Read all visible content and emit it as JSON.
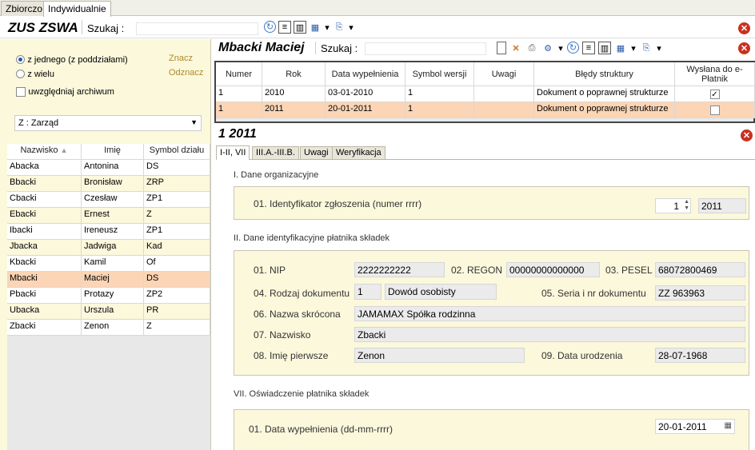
{
  "top_tabs": [
    "Zbiorczo",
    "Indywidualnie"
  ],
  "left": {
    "title": "ZUS ZSWA",
    "search_label": "Szukaj  :",
    "search_value": "",
    "radio_single": "z jednego (z poddziałami)",
    "radio_many": "z wielu",
    "link_mark": "Znacz",
    "link_unmark": "Odznacz",
    "archive_label": "uwzględniaj archiwum",
    "department_select": "Z : Zarząd",
    "columns": [
      "Nazwisko",
      "Imię",
      "Symbol działu"
    ],
    "rows": [
      {
        "nazwisko": "Abacka",
        "imie": "Antonina",
        "symbol": "DS"
      },
      {
        "nazwisko": "Bbacki",
        "imie": "Bronisław",
        "symbol": "ZRP"
      },
      {
        "nazwisko": "Cbacki",
        "imie": "Czesław",
        "symbol": "ZP1"
      },
      {
        "nazwisko": "Ebacki",
        "imie": "Ernest",
        "symbol": "Z"
      },
      {
        "nazwisko": "Ibacki",
        "imie": "Ireneusz",
        "symbol": "ZP1"
      },
      {
        "nazwisko": "Jbacka",
        "imie": "Jadwiga",
        "symbol": "Kad"
      },
      {
        "nazwisko": "Kbacki",
        "imie": "Kamil",
        "symbol": "Of"
      },
      {
        "nazwisko": "Mbacki",
        "imie": "Maciej",
        "symbol": "DS"
      },
      {
        "nazwisko": "Pbacki",
        "imie": "Protazy",
        "symbol": "ZP2"
      },
      {
        "nazwisko": "Ubacka",
        "imie": "Urszula",
        "symbol": "PR"
      },
      {
        "nazwisko": "Zbacki",
        "imie": "Zenon",
        "symbol": "Z"
      }
    ]
  },
  "right": {
    "title": "Mbacki Maciej",
    "search_label": "Szukaj  :",
    "search_value": "",
    "columns": [
      "Numer",
      "Rok",
      "Data wypełnienia",
      "Symbol wersji",
      "Uwagi",
      "Błędy struktury",
      "Wysłana do e-Płatnik"
    ],
    "rows": [
      {
        "numer": "1",
        "rok": "2010",
        "data": "03-01-2010",
        "symbol": "1",
        "uwagi": "",
        "bledy": "Dokument o poprawnej strukturze",
        "wyslana": true
      },
      {
        "numer": "1",
        "rok": "2011",
        "data": "20-01-2011",
        "symbol": "1",
        "uwagi": "",
        "bledy": "Dokument o poprawnej strukturze",
        "wyslana": false
      }
    ]
  },
  "detail": {
    "title": "1 2011",
    "tabs": [
      "I-II, VII",
      "III.A.-III.B.",
      "Uwagi",
      "Weryfikacja"
    ],
    "section1": "I. Dane organizacyjne",
    "id_label": "01. Identyfikator zgłoszenia (numer rrrr)",
    "id_number": "1",
    "id_year": "2011",
    "section2": "II. Dane identyfikacyjne płatnika składek",
    "nip_label": "01. NIP",
    "nip": "2222222222",
    "regon_label": "02. REGON",
    "regon": "00000000000000",
    "pesel_label": "03. PESEL",
    "pesel": "68072800469",
    "doc_type_label": "04. Rodzaj dokumentu",
    "doc_type_code": "1",
    "doc_type": "Dowód osobisty",
    "doc_no_label": "05. Seria i nr dokumentu",
    "doc_no": "ZZ 963963",
    "short_name_label": "06. Nazwa skrócona",
    "short_name": "JAMAMAX Spółka rodzinna",
    "surname_label": "07. Nazwisko",
    "surname": "Zbacki",
    "firstname_label": "08. Imię pierwsze",
    "firstname": "Zenon",
    "birth_label": "09. Data urodzenia",
    "birth": "28-07-1968",
    "section3": "VII. Oświadczenie płatnika składek",
    "fill_date_label": "01. Data wypełnienia (dd-mm-rrrr)",
    "fill_date": "20-01-2011"
  }
}
